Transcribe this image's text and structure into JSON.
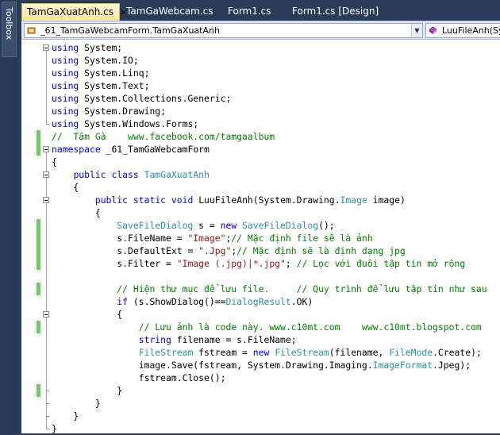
{
  "toolbox": {
    "label": "Toolbox"
  },
  "tabs": [
    {
      "label": "TamGaXuatAnh.cs",
      "active": true,
      "close": "×"
    },
    {
      "label": "TamGaWebcam.cs",
      "active": false
    },
    {
      "label": "Form1.cs",
      "active": false
    },
    {
      "label": "Form1.cs [Design]",
      "active": false
    }
  ],
  "navbar": {
    "type_combo": "_61_TamGaWebcamForm.TamGaXuatAnh",
    "member_combo": "LuuFileAnh(Sy"
  },
  "colors": {
    "keyword": "#0000ff",
    "type": "#2b91af",
    "string": "#a31515",
    "comment": "#008000",
    "changed_margin": "#6dcd5b"
  },
  "code_lines": [
    {
      "changed": false,
      "tokens": [
        [
          "kw",
          "using"
        ],
        [
          "pl",
          " System;"
        ]
      ]
    },
    {
      "changed": false,
      "tokens": [
        [
          "kw",
          "using"
        ],
        [
          "pl",
          " System.IO;"
        ]
      ]
    },
    {
      "changed": false,
      "tokens": [
        [
          "kw",
          "using"
        ],
        [
          "pl",
          " System.Linq;"
        ]
      ]
    },
    {
      "changed": false,
      "tokens": [
        [
          "kw",
          "using"
        ],
        [
          "pl",
          " System.Text;"
        ]
      ]
    },
    {
      "changed": false,
      "tokens": [
        [
          "kw",
          "using"
        ],
        [
          "pl",
          " System.Collections.Generic;"
        ]
      ]
    },
    {
      "changed": false,
      "tokens": [
        [
          "kw",
          "using"
        ],
        [
          "pl",
          " System.Drawing;"
        ]
      ]
    },
    {
      "changed": false,
      "tokens": [
        [
          "kw",
          "using"
        ],
        [
          "pl",
          " System.Windows.Forms;"
        ]
      ]
    },
    {
      "changed": true,
      "tokens": [
        [
          "cm",
          "//  Tâm Gà    www.facebook.com/tamgaalbum"
        ]
      ]
    },
    {
      "changed": true,
      "tokens": [
        [
          "kw",
          "namespace"
        ],
        [
          "pl",
          " _61_TamGaWebcamForm"
        ]
      ]
    },
    {
      "changed": false,
      "tokens": [
        [
          "pl",
          "{"
        ]
      ]
    },
    {
      "changed": false,
      "tokens": [
        [
          "pl",
          "    "
        ],
        [
          "kw",
          "public"
        ],
        [
          "pl",
          " "
        ],
        [
          "kw",
          "class"
        ],
        [
          "pl",
          " "
        ],
        [
          "ty",
          "TamGaXuatAnh"
        ]
      ]
    },
    {
      "changed": false,
      "tokens": [
        [
          "pl",
          "    {"
        ]
      ]
    },
    {
      "changed": false,
      "tokens": [
        [
          "pl",
          "        "
        ],
        [
          "kw",
          "public"
        ],
        [
          "pl",
          " "
        ],
        [
          "kw",
          "static"
        ],
        [
          "pl",
          " "
        ],
        [
          "kw",
          "void"
        ],
        [
          "pl",
          " LuuFileAnh(System.Drawing."
        ],
        [
          "ty",
          "Image"
        ],
        [
          "pl",
          " image)"
        ]
      ]
    },
    {
      "changed": false,
      "tokens": [
        [
          "pl",
          "        {"
        ]
      ]
    },
    {
      "changed": true,
      "tokens": [
        [
          "pl",
          "            "
        ],
        [
          "ty",
          "SaveFileDialog"
        ],
        [
          "pl",
          " s = "
        ],
        [
          "kw",
          "new"
        ],
        [
          "pl",
          " "
        ],
        [
          "ty",
          "SaveFileDialog"
        ],
        [
          "pl",
          "();"
        ]
      ]
    },
    {
      "changed": true,
      "tokens": [
        [
          "pl",
          "            s.FileName = "
        ],
        [
          "str",
          "\"Image\""
        ],
        [
          "pl",
          ";"
        ],
        [
          "cm",
          "// Mặc định file sẽ là ảnh"
        ]
      ]
    },
    {
      "changed": true,
      "tokens": [
        [
          "pl",
          "            s.DefaultExt = "
        ],
        [
          "str",
          "\".Jpg\""
        ],
        [
          "pl",
          ";"
        ],
        [
          "cm",
          "// Mặc định sẽ là định dạng jpg"
        ]
      ]
    },
    {
      "changed": true,
      "tokens": [
        [
          "pl",
          "            s.Filter = "
        ],
        [
          "str",
          "\"Image (.jpg)|*.jpg\""
        ],
        [
          "pl",
          "; "
        ],
        [
          "cm",
          "// Lọc với đuôi tập tin mở rộng"
        ]
      ]
    },
    {
      "changed": false,
      "tokens": [
        [
          "pl",
          ""
        ]
      ]
    },
    {
      "changed": true,
      "tokens": [
        [
          "pl",
          "            "
        ],
        [
          "cm",
          "// Hiện thư mục để lưu file.     // Quy trình để lưu tập tin như sau"
        ]
      ]
    },
    {
      "changed": false,
      "tokens": [
        [
          "pl",
          "            "
        ],
        [
          "kw",
          "if"
        ],
        [
          "pl",
          " (s.ShowDialog()=="
        ],
        [
          "ty",
          "DialogResult"
        ],
        [
          "pl",
          ".OK)"
        ]
      ]
    },
    {
      "changed": false,
      "tokens": [
        [
          "pl",
          "            {"
        ]
      ]
    },
    {
      "changed": true,
      "tokens": [
        [
          "pl",
          "                "
        ],
        [
          "cm",
          "// Lưu ảnh là code này. www.c10mt.com    www.c10mt.blogspot.com"
        ]
      ]
    },
    {
      "changed": false,
      "tokens": [
        [
          "pl",
          "                "
        ],
        [
          "kw",
          "string"
        ],
        [
          "pl",
          " filename = s.FileName;"
        ]
      ]
    },
    {
      "changed": false,
      "tokens": [
        [
          "pl",
          "                "
        ],
        [
          "ty",
          "FileStream"
        ],
        [
          "pl",
          " fstream = "
        ],
        [
          "kw",
          "new"
        ],
        [
          "pl",
          " "
        ],
        [
          "ty",
          "FileStream"
        ],
        [
          "pl",
          "(filename, "
        ],
        [
          "ty",
          "FileMode"
        ],
        [
          "pl",
          ".Create);"
        ]
      ]
    },
    {
      "changed": false,
      "tokens": [
        [
          "pl",
          "                image.Save(fstream, System.Drawing.Imaging."
        ],
        [
          "ty",
          "ImageFormat"
        ],
        [
          "pl",
          ".Jpeg);"
        ]
      ]
    },
    {
      "changed": false,
      "tokens": [
        [
          "pl",
          "                fstream.Close();"
        ]
      ]
    },
    {
      "changed": true,
      "tokens": [
        [
          "pl",
          "            }"
        ]
      ]
    },
    {
      "changed": false,
      "tokens": [
        [
          "pl",
          "        }"
        ]
      ]
    },
    {
      "changed": false,
      "tokens": [
        [
          "pl",
          "    }"
        ]
      ]
    },
    {
      "changed": false,
      "tokens": [
        [
          "pl",
          "}"
        ]
      ]
    }
  ]
}
